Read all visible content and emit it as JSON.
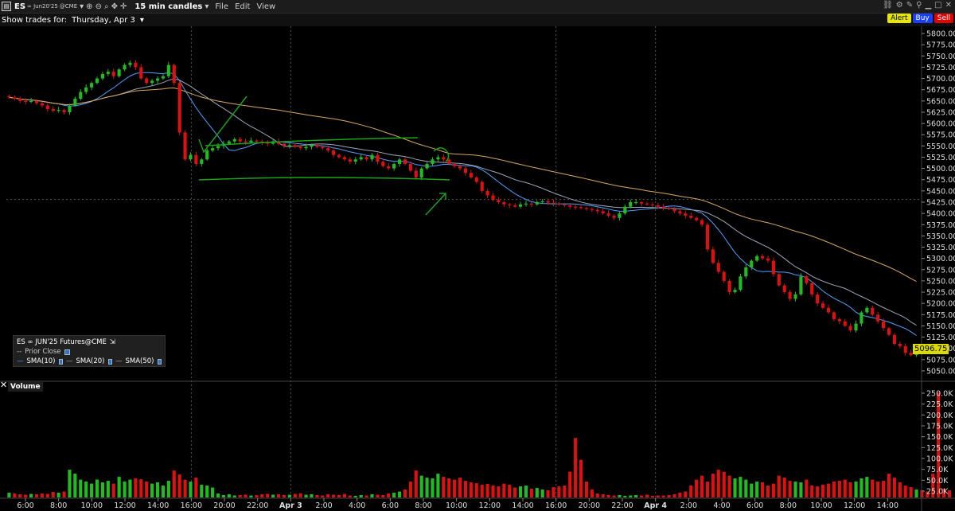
{
  "window": {
    "symbol": "ES",
    "contract": "∞ Jun20'25",
    "exchange": "@CME",
    "bar_size": "15 min candles",
    "menus": [
      "File",
      "Edit",
      "View"
    ]
  },
  "toolbar": {
    "show_trades_label": "Show trades for:",
    "show_trades_value": "Thursday, Apr 3",
    "alert_label": "Alert",
    "buy_label": "Buy",
    "sell_label": "Sell"
  },
  "legend": {
    "title": "ES ∞ JUN'25 Futures@CME",
    "prior_close": "Prior Close",
    "sma10": "SMA(10)",
    "sma20": "SMA(20)",
    "sma50": "SMA(50)"
  },
  "volume_panel": {
    "title": "Volume"
  },
  "last_price": "5096.75",
  "colors": {
    "up": "#22bb22",
    "down": "#dd1111",
    "sma10": "#4aa0ff",
    "sma20": "#9aa7b8",
    "sma50": "#d8a860",
    "annotation": "#19a319"
  },
  "chart_data": {
    "type": "candlestick",
    "price_axis": {
      "ylim": [
        5037.5,
        5812.5
      ],
      "ticks": [
        5800,
        5775,
        5750,
        5725,
        5700,
        5675,
        5650,
        5625,
        5600,
        5575,
        5550,
        5525,
        5500,
        5475,
        5450,
        5425,
        5400,
        5375,
        5350,
        5325,
        5300,
        5275,
        5250,
        5225,
        5200,
        5175,
        5150,
        5125,
        5100,
        5075,
        5050
      ]
    },
    "volume_axis": {
      "tick_labels": [
        "250.0K",
        "225.0K",
        "200.0K",
        "175.0K",
        "150.0K",
        "125.0K",
        "100.0K",
        "75.0K",
        "50.0K",
        "25.0K"
      ]
    },
    "time_labels": [
      "6:00",
      "8:00",
      "10:00",
      "12:00",
      "14:00",
      "16:00",
      "20:00",
      "22:00",
      "Apr 3",
      "2:00",
      "4:00",
      "6:00",
      "8:00",
      "10:00",
      "12:00",
      "14:00",
      "16:00",
      "20:00",
      "22:00",
      "Apr 4",
      "2:00",
      "4:00",
      "6:00",
      "8:00",
      "10:00",
      "12:00",
      "14:00"
    ],
    "session_breaks": [
      "16:00",
      "Apr 3",
      "16:00",
      "Apr 4"
    ],
    "closes": [
      5658,
      5655,
      5650,
      5648,
      5650,
      5645,
      5640,
      5632,
      5628,
      5630,
      5625,
      5640,
      5655,
      5670,
      5680,
      5690,
      5700,
      5710,
      5715,
      5705,
      5720,
      5730,
      5735,
      5725,
      5700,
      5690,
      5695,
      5700,
      5705,
      5730,
      5690,
      5580,
      5520,
      5530,
      5510,
      5520,
      5540,
      5545,
      5550,
      5555,
      5560,
      5565,
      5560,
      5558,
      5562,
      5560,
      5558,
      5555,
      5560,
      5555,
      5550,
      5552,
      5548,
      5545,
      5548,
      5552,
      5548,
      5545,
      5540,
      5530,
      5525,
      5520,
      5515,
      5520,
      5525,
      5520,
      5530,
      5515,
      5505,
      5500,
      5510,
      5520,
      5510,
      5495,
      5480,
      5500,
      5510,
      5520,
      5525,
      5520,
      5510,
      5505,
      5500,
      5490,
      5480,
      5470,
      5450,
      5440,
      5430,
      5425,
      5420,
      5418,
      5415,
      5420,
      5422,
      5420,
      5425,
      5427,
      5424,
      5422,
      5420,
      5418,
      5415,
      5414,
      5412,
      5410,
      5408,
      5405,
      5400,
      5395,
      5390,
      5400,
      5415,
      5425,
      5425,
      5422,
      5420,
      5418,
      5415,
      5412,
      5410,
      5405,
      5400,
      5395,
      5390,
      5385,
      5375,
      5320,
      5290,
      5270,
      5250,
      5225,
      5230,
      5260,
      5280,
      5295,
      5305,
      5300,
      5295,
      5265,
      5240,
      5225,
      5210,
      5220,
      5260,
      5245,
      5220,
      5200,
      5190,
      5180,
      5165,
      5160,
      5150,
      5140,
      5155,
      5180,
      5190,
      5175,
      5160,
      5145,
      5130,
      5110,
      5105,
      5090,
      5085,
      5096
    ],
    "volumes": [
      12,
      10,
      8,
      7,
      9,
      8,
      10,
      9,
      14,
      12,
      15,
      70,
      60,
      45,
      40,
      35,
      45,
      38,
      42,
      35,
      52,
      40,
      45,
      48,
      46,
      40,
      35,
      38,
      30,
      42,
      68,
      58,
      45,
      40,
      50,
      32,
      30,
      25,
      10,
      6,
      8,
      5,
      6,
      7,
      5,
      6,
      8,
      9,
      7,
      8,
      6,
      7,
      9,
      10,
      7,
      8,
      6,
      5,
      8,
      7,
      6,
      9,
      5,
      4,
      6,
      5,
      8,
      7,
      6,
      10,
      12,
      15,
      20,
      40,
      68,
      55,
      50,
      48,
      60,
      52,
      48,
      45,
      50,
      42,
      38,
      36,
      32,
      34,
      30,
      28,
      35,
      32,
      25,
      28,
      30,
      22,
      24,
      20,
      18,
      26,
      28,
      30,
      65,
      150,
      95,
      40,
      20,
      10,
      8,
      6,
      5,
      6,
      4,
      5,
      6,
      5,
      7,
      4,
      5,
      5,
      6,
      8,
      12,
      15,
      30,
      45,
      55,
      40,
      60,
      70,
      65,
      55,
      48,
      52,
      45,
      35,
      40,
      38,
      30,
      35,
      55,
      50,
      42,
      40,
      38,
      45,
      30,
      28,
      32,
      35,
      40,
      42,
      45,
      38,
      40,
      48,
      52,
      45,
      40,
      42,
      60,
      50,
      38,
      30,
      26,
      20,
      18,
      15,
      60,
      265,
      22,
      18
    ]
  }
}
